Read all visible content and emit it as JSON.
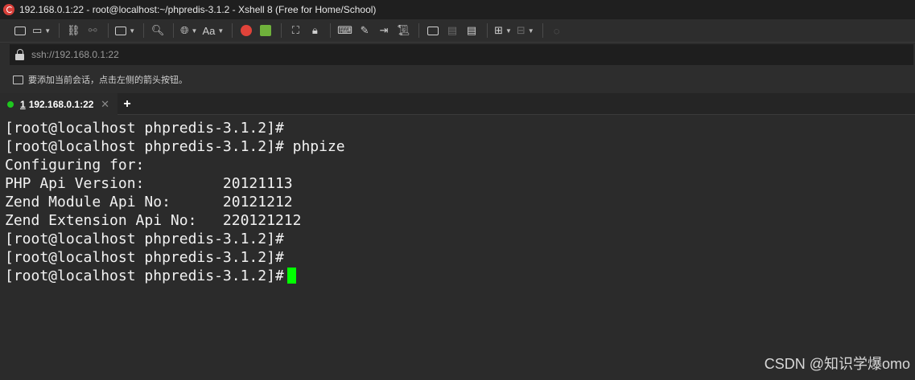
{
  "window": {
    "title": "192.168.0.1:22 - root@localhost:~/phpredis-3.1.2 - Xshell 8 (Free for Home/School)",
    "app_icon": "xshell-logo-icon"
  },
  "toolbar": {
    "font_button_label": "Aa",
    "icons": [
      "new-session-icon",
      "open-folder-icon",
      "link-icon",
      "unlink-icon",
      "window-icon",
      "search-icon",
      "globe-icon",
      "font-icon",
      "xshell-icon",
      "xftp-icon",
      "fullscreen-icon",
      "lock-icon",
      "keyboard-icon",
      "compose-icon",
      "transfer-icon",
      "script-icon",
      "new-tab-icon",
      "log-icon",
      "notes-icon",
      "add-folder-icon",
      "layout-icon",
      "help-icon"
    ]
  },
  "address": {
    "url": "ssh://192.168.0.1:22"
  },
  "session_bar": {
    "hint": "要添加当前会话，点击左侧的箭头按钮。"
  },
  "tabs": [
    {
      "index": "1",
      "label": "192.168.0.1:22",
      "active": true,
      "status_color": "#1ec71e"
    }
  ],
  "tab_add_label": "+",
  "tab_close_label": "✕",
  "terminal": {
    "lines": [
      "[root@localhost phpredis-3.1.2]#",
      "[root@localhost phpredis-3.1.2]# phpize",
      "Configuring for:",
      "PHP Api Version:         20121113",
      "Zend Module Api No:      20121212",
      "Zend Extension Api No:   220121212",
      "[root@localhost phpredis-3.1.2]#",
      "[root@localhost phpredis-3.1.2]#",
      "[root@localhost phpredis-3.1.2]#"
    ],
    "cursor_color": "#00ff00"
  },
  "watermark": "CSDN @知识学爆omo"
}
